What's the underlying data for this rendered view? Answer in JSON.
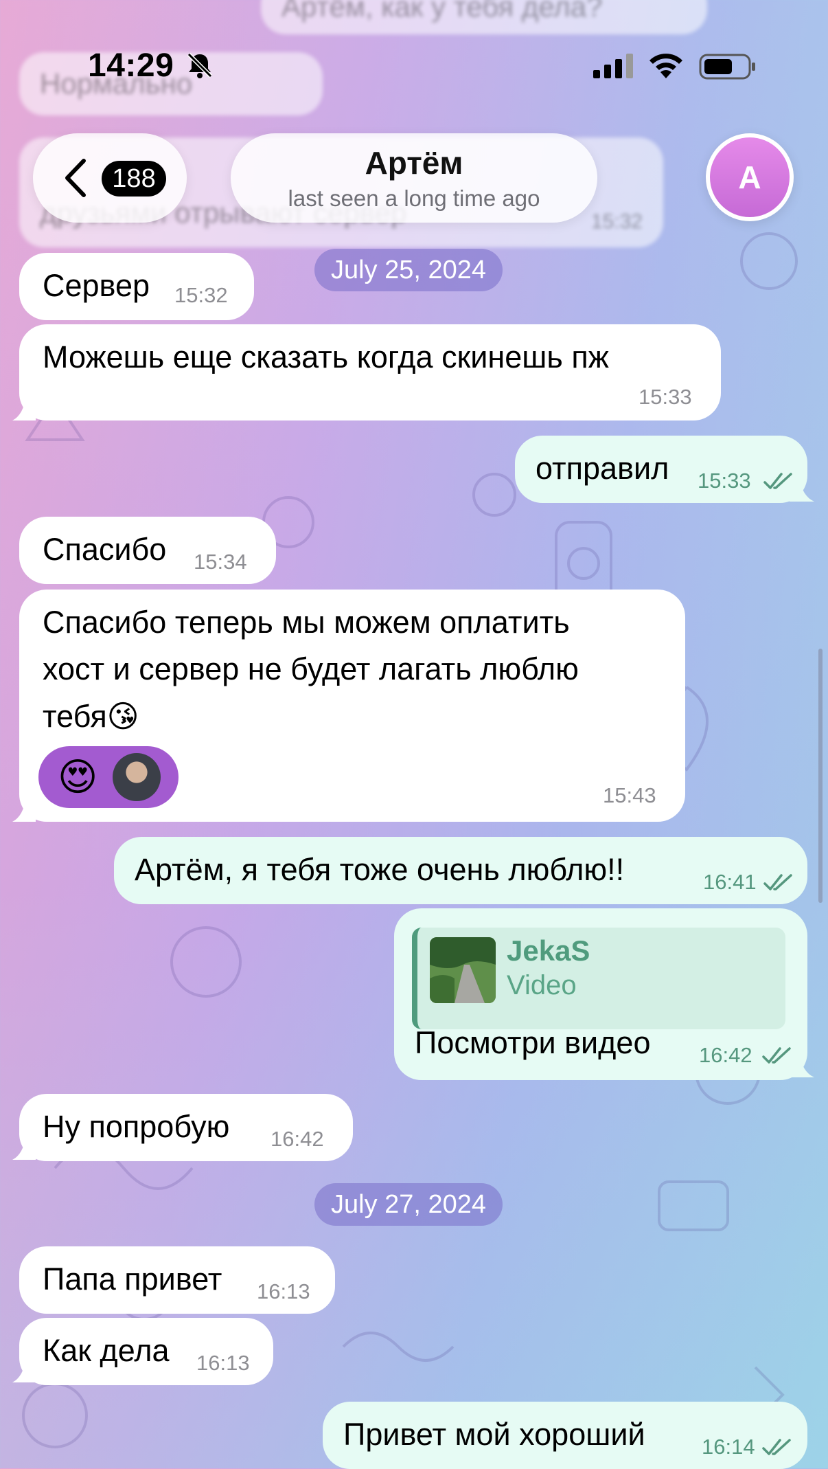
{
  "status_bar": {
    "time": "14:29"
  },
  "header": {
    "back_count": "188",
    "name": "Артём",
    "status": "last seen a long time ago",
    "avatar_letter": "A"
  },
  "ghost_messages": [
    {
      "text": "Артём, как у тебя дела?"
    },
    {
      "text": "Нормально"
    },
    {
      "text": "друзьями отрывают сервер",
      "time": "15:32"
    }
  ],
  "dates": [
    "July 25, 2024",
    "July 27, 2024"
  ],
  "messages": [
    {
      "dir": "in",
      "text": "Сервер",
      "time": "15:32"
    },
    {
      "dir": "in",
      "text": "Можешь еще сказать когда скинешь пж",
      "time": "15:33"
    },
    {
      "dir": "out",
      "text": "отправил",
      "time": "15:33"
    },
    {
      "dir": "in",
      "text": "Спасибо",
      "time": "15:34"
    },
    {
      "dir": "in",
      "lines": [
        "Спасибо теперь мы можем оплатить",
        "хост и сервер не будет лагать люблю",
        "тебя😘"
      ],
      "time": "15:43",
      "reaction": "😍"
    },
    {
      "dir": "out",
      "text": "Артём, я тебя тоже очень люблю!!",
      "time": "16:41"
    },
    {
      "dir": "out",
      "reply_name": "JekaS",
      "reply_type": "Video",
      "text": "Посмотри видео",
      "time": "16:42"
    },
    {
      "dir": "in",
      "text": "Ну попробую",
      "time": "16:42"
    },
    {
      "dir": "in",
      "text": "Папа привет",
      "time": "16:13"
    },
    {
      "dir": "in",
      "text": "Как дела",
      "time": "16:13"
    },
    {
      "dir": "out",
      "text": "Привет мой хороший",
      "time": "16:14"
    }
  ]
}
